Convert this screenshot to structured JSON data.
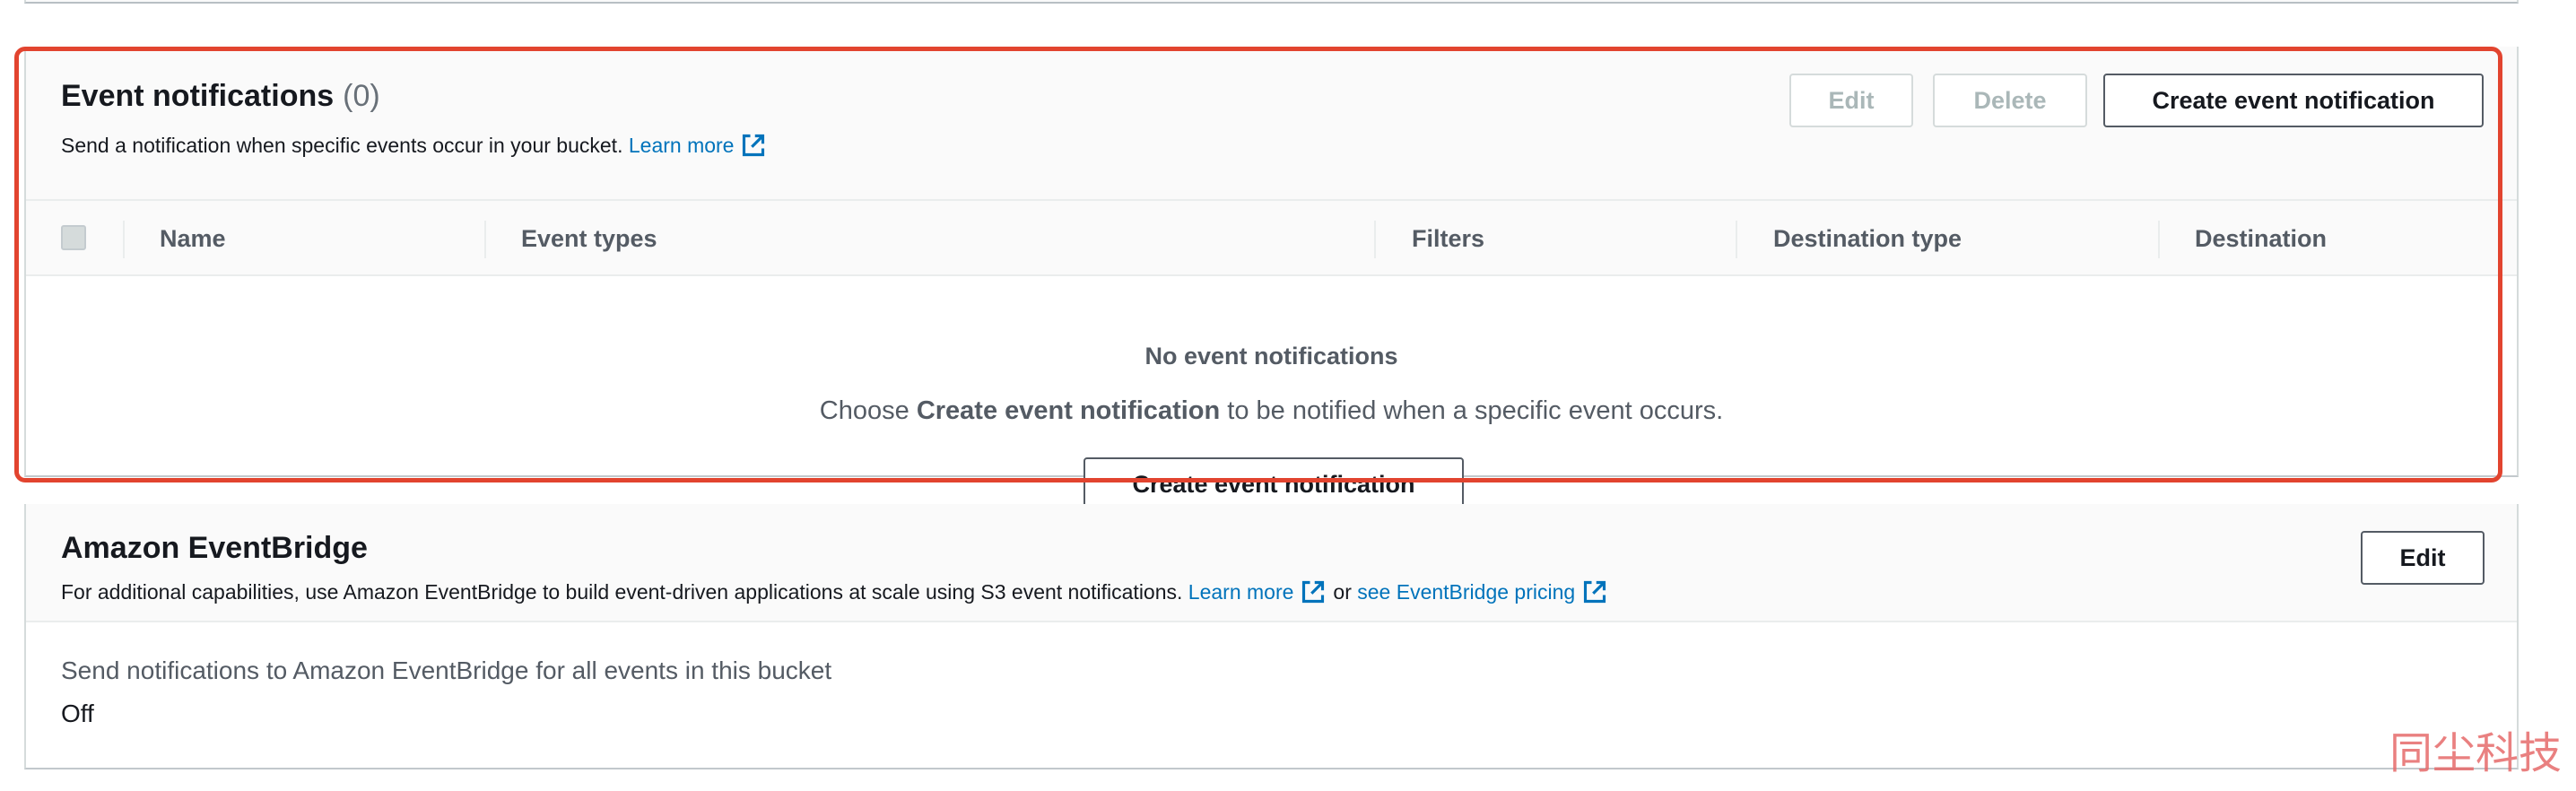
{
  "event_notifications": {
    "title": "Event notifications",
    "count": "(0)",
    "description": "Send a notification when specific events occur in your bucket.",
    "learn_more": "Learn more",
    "buttons": {
      "edit": "Edit",
      "delete": "Delete",
      "create": "Create event notification"
    },
    "columns": [
      "Name",
      "Event types",
      "Filters",
      "Destination type",
      "Destination"
    ],
    "empty": {
      "title": "No event notifications",
      "text_prefix": "Choose",
      "text_bold": "Create event notification",
      "text_suffix": "to be notified when a specific event occurs.",
      "button": "Create event notification"
    }
  },
  "eventbridge": {
    "title": "Amazon EventBridge",
    "description": "For additional capabilities, use Amazon EventBridge to build event-driven applications at scale using S3 event notifications.",
    "learn_more": "Learn more",
    "or": "or",
    "pricing_link": "see EventBridge pricing",
    "edit_button": "Edit",
    "setting_label": "Send notifications to Amazon EventBridge for all events in this bucket",
    "setting_value": "Off"
  },
  "watermark": "同尘科技",
  "colors": {
    "link": "#0073bb",
    "highlight": "#e2442f",
    "text": "#16191f",
    "muted": "#545b64"
  },
  "icons": {
    "external_link": "external-link-icon"
  }
}
